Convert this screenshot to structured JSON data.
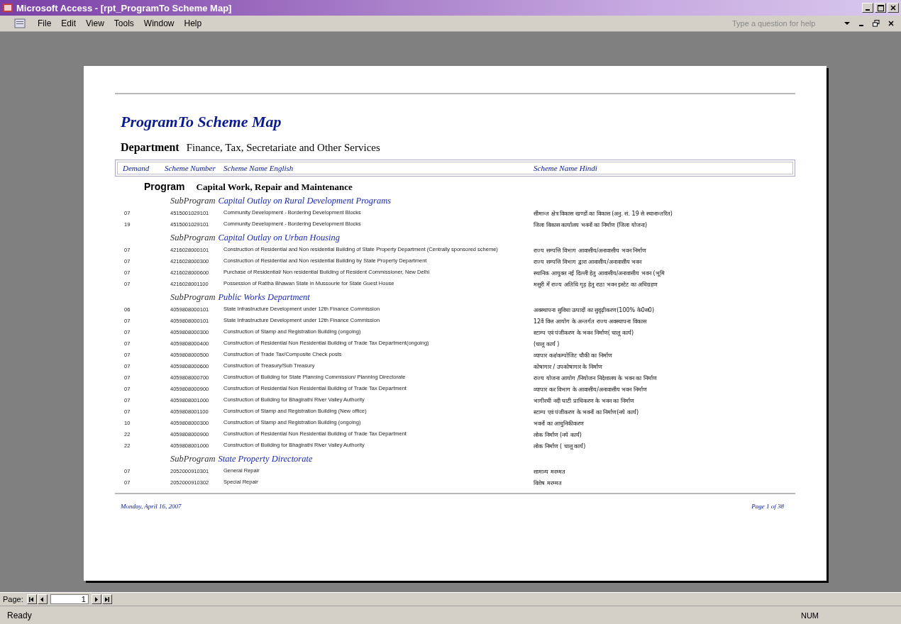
{
  "window": {
    "title": "Microsoft Access - [rpt_ProgramTo Scheme Map]"
  },
  "menu": [
    "File",
    "Edit",
    "View",
    "Tools",
    "Window",
    "Help"
  ],
  "help_field": {
    "placeholder": "Type a question for help"
  },
  "report": {
    "title": "ProgramTo Scheme Map",
    "department_label": "Department",
    "department": "Finance, Tax, Secretariate and Other Services",
    "columns": [
      "Demand",
      "Scheme Number",
      "Scheme Name English",
      "Scheme Name Hindi"
    ],
    "programs": [
      {
        "label": "Program",
        "name": "Capital Work, Repair and Maintenance",
        "subprograms": [
          {
            "label": "SubProgram",
            "name": "Capital Outlay on Rural Development Programs",
            "rows": [
              {
                "demand": "07",
                "scheme_number": "4515001029101",
                "name_english": "Community Development - Bordering Development Blocks",
                "name_hindi": "सीमान्त क्षेत्र विकास खण्डों का विकास (अनु. सं. 19 से स्थानान्तरित)"
              },
              {
                "demand": "19",
                "scheme_number": "4515001029101",
                "name_english": "Community Development - Bordering Development Blocks",
                "name_hindi": "जिला विकास कार्यालय भवनों का निर्माण (जिला योजना)"
              }
            ]
          },
          {
            "label": "SubProgram",
            "name": "Capital Outlay on Urban Housing",
            "rows": [
              {
                "demand": "07",
                "scheme_number": "4216028000101",
                "name_english": "Construction of Residential and Non residential Building of State Property Department (Centrally sponsored scheme)",
                "name_hindi": "राज्य सम्पत्ति विभाग आवासीय/अनावासीय भवन निर्माण"
              },
              {
                "demand": "07",
                "scheme_number": "4216028000300",
                "name_english": "Construction of Residential and Non residential Building by State Property Department",
                "name_hindi": "राज्य सम्पत्ति विभाग द्वारा आवासीय/अनावासीय भवन"
              },
              {
                "demand": "07",
                "scheme_number": "4216028000600",
                "name_english": "Purchase of Residential/ Non residential Building of Resident Commissioner, New Delhi",
                "name_hindi": "स्थानिक आयुक्त नई दिल्ली हेतु आवासीय/अनावासीय भवन (भूमि"
              },
              {
                "demand": "07",
                "scheme_number": "4216028001100",
                "name_english": "Possession of Rattha Bhawan State in Mussourie for State Guest House",
                "name_hindi": "मसूरी में राज्य अतिथि गृह हेतु राठा भवन इस्टेट का अधिग्रहण"
              }
            ]
          },
          {
            "label": "SubProgram",
            "name": "Public Works Department",
            "rows": [
              {
                "demand": "06",
                "scheme_number": "4059808000101",
                "name_english": "State Infrastructure Development under 12th Finance Commission",
                "name_hindi": "अवस्थापना सुविधा उत्पादों का सुदृढ़ीकरण(100% के0स0)"
              },
              {
                "demand": "07",
                "scheme_number": "4059808000101",
                "name_english": "State Infrastructure Development under 12th Finance Commission",
                "name_hindi": "12वें वित्त आयोग के अन्तर्गत राज्य अवस्थापना विकास"
              },
              {
                "demand": "07",
                "scheme_number": "4059808000300",
                "name_english": "Construction of Stamp and Registration Building (ongoing)",
                "name_hindi": "स्टाम्प एवं पंजीकरण के भवन निर्माण( चालू कार्य)"
              },
              {
                "demand": "07",
                "scheme_number": "4059808000400",
                "name_english": "Construction of Residential Non Residential Building of Trade Tax Department(ongoing)",
                "name_hindi": "(चालू कार्य )"
              },
              {
                "demand": "07",
                "scheme_number": "4059808000500",
                "name_english": "Construction of Trade Tax/Composite Check posts",
                "name_hindi": "व्यापार कर/कम्पोजिट चौकी का निर्माण"
              },
              {
                "demand": "07",
                "scheme_number": "4059808000600",
                "name_english": "Construction of Treasury/Sub Treasury",
                "name_hindi": "कोषागार / उपकोषागार के निर्माण"
              },
              {
                "demand": "07",
                "scheme_number": "4059808000700",
                "name_english": "Construction of Building for State Planning Commission/ Planning Directorate",
                "name_hindi": "राज्य योजना आयोग /नियोजन निदेशालय के भवन का निर्माण"
              },
              {
                "demand": "07",
                "scheme_number": "4059808000900",
                "name_english": "Construction of Residential Non Residential Building of Trade Tax Department",
                "name_hindi": "व्यापार कर विभाग के आवासीय/अनावासीय भवन निर्माण"
              },
              {
                "demand": "07",
                "scheme_number": "4059808001000",
                "name_english": "Construction of Building for Bhagirathi River Valley Authority",
                "name_hindi": "भागीरथी नदी घाटी प्राधिकरण के भवन का निर्माण"
              },
              {
                "demand": "07",
                "scheme_number": "4059808001100",
                "name_english": "Construction of Stamp and Registration Building (New office)",
                "name_hindi": "स्टाम्प एवं पंजीकरण के भवनों का निर्माण(नये कार्य)"
              },
              {
                "demand": "10",
                "scheme_number": "4059808000300",
                "name_english": "Construction of Stamp and Registration Building (ongoing)",
                "name_hindi": "भवनों का आधुनिकीकरण"
              },
              {
                "demand": "22",
                "scheme_number": "4059808000900",
                "name_english": "Construction of Residential Non Residential Building of Trade Tax Department",
                "name_hindi": "लोक निर्माण (नये कार्य)"
              },
              {
                "demand": "22",
                "scheme_number": "4059808001000",
                "name_english": "Construction of Building for Bhagirathi River Valley Authority",
                "name_hindi": "लोक निर्माण ( चालू कार्य)"
              }
            ]
          },
          {
            "label": "SubProgram",
            "name": "State Property Directorate",
            "rows": [
              {
                "demand": "07",
                "scheme_number": "2052000910301",
                "name_english": "General Repair",
                "name_hindi": "सामान्य मरम्मत"
              },
              {
                "demand": "07",
                "scheme_number": "2052000910302",
                "name_english": "Special Repair",
                "name_hindi": "विशेष मरम्मत"
              }
            ]
          }
        ]
      }
    ],
    "footer": {
      "date": "Monday, April 16, 2007",
      "page": "Page 1 of 38"
    }
  },
  "navigator": {
    "label": "Page:",
    "value": "1"
  },
  "status_bar": {
    "text": "Ready",
    "indicator": "NUM"
  }
}
